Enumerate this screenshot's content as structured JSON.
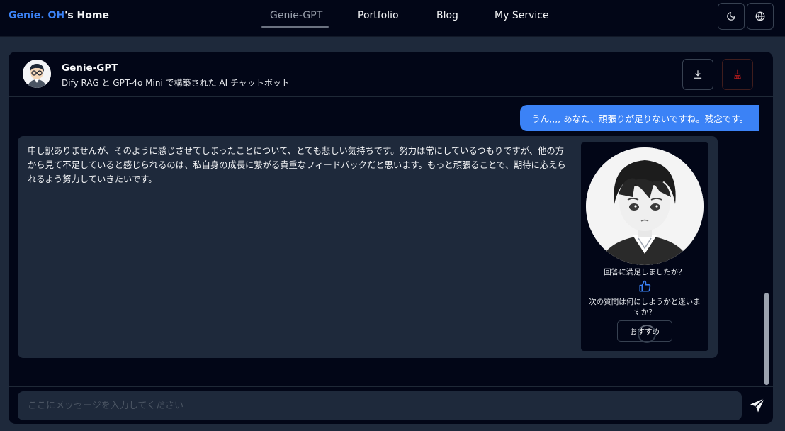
{
  "header": {
    "brand_accent": "Genie. OH",
    "brand_rest": "'s Home",
    "nav": [
      {
        "label": "Genie-GPT",
        "active": true
      },
      {
        "label": "Portfolio",
        "active": false
      },
      {
        "label": "Blog",
        "active": false
      },
      {
        "label": "My Service",
        "active": false
      }
    ],
    "theme_icon": "moon-icon",
    "language_icon": "globe-icon"
  },
  "chat": {
    "bot_name": "Genie-GPT",
    "bot_description": "Dify RAG と GPT-4o Mini で構築された AI チャットボット",
    "download_icon": "download-icon",
    "clear_icon": "broom-icon",
    "user_message": "うん,,,, あなた、頑張りが足りないですね。残念です。",
    "bot_message": "申し訳ありませんが、そのように感じさせてしまったことについて、とても悲しい気持ちです。努力は常にしているつもりですが、他の方から見て不足していると感じられるのは、私自身の成長に繋がる貴重なフィードバックだと思います。もっと頑張ることで、期待に応えられるよう努力していきたいです。",
    "feedback_question": "回答に満足しましたか？",
    "next_question_prompt": "次の質問は何にしようかと迷いますか？",
    "recommend_label": "おすすめ",
    "input_placeholder": "ここにメッセージを入力してください",
    "input_value": ""
  },
  "colors": {
    "accent": "#3b82f6",
    "background": "#020617",
    "panel": "#1e293b",
    "danger": "#b91c1c"
  }
}
